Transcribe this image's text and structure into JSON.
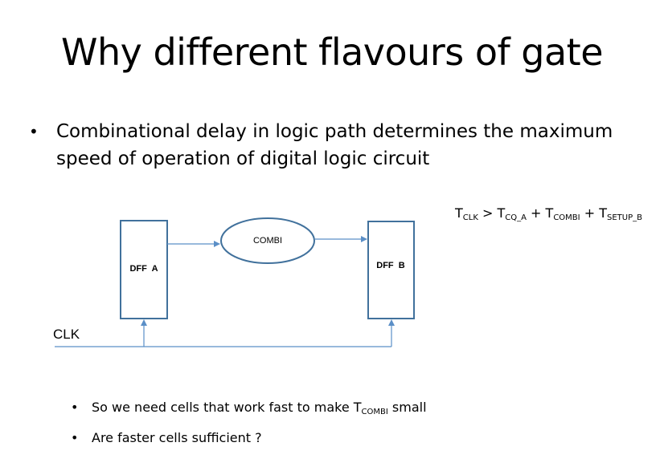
{
  "slide": {
    "title": "Why different flavours of gate",
    "bullet": {
      "marker": "•",
      "text": "Combinational delay in logic path determines the maximum speed of operation of digital logic circuit"
    },
    "formula": {
      "t1": "T",
      "s1": "CLK",
      "op": " > ",
      "t2": "T",
      "s2": "CQ_A",
      "p1": " + ",
      "t3": "T",
      "s3": "COMBI",
      "p2": " + ",
      "t4": "T",
      "s4": "SETUP_B"
    },
    "sub_bullets": [
      {
        "marker": "•",
        "pre": "So we need cells that work fast to make T",
        "sub": "COMBI",
        "post": " small"
      },
      {
        "marker": "•",
        "text": "Are faster cells sufficient ?"
      }
    ]
  },
  "diagram": {
    "dff_a_label": "DFF  A",
    "combi_label": "COMBI",
    "dff_b_label": "DFF  B",
    "clk_label": "CLK",
    "stroke_color": "#41719c",
    "line_color": "#5b8fc7"
  }
}
